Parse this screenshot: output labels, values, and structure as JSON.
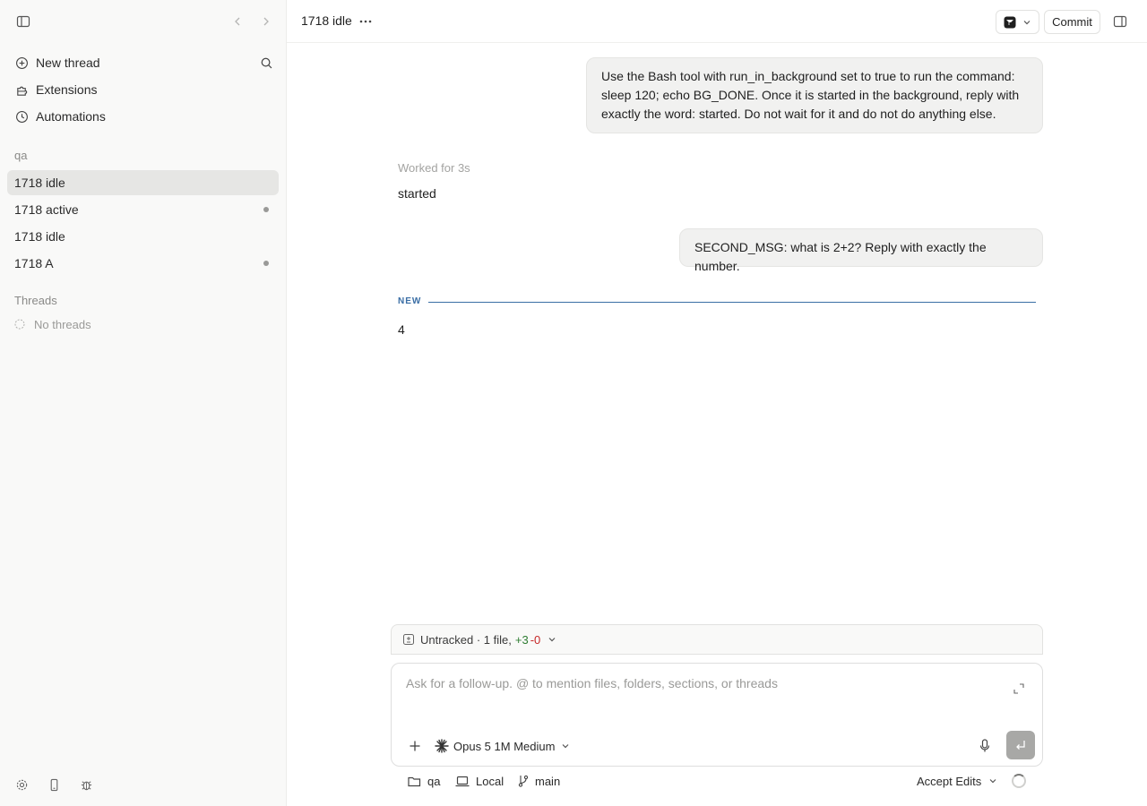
{
  "sidebar": {
    "nav": [
      {
        "label": "New thread",
        "icon": "plus-circle-icon"
      },
      {
        "label": "Extensions",
        "icon": "puzzle-icon"
      },
      {
        "label": "Automations",
        "icon": "clock-icon"
      }
    ],
    "project_label": "qa",
    "project_threads": [
      {
        "label": "1718 idle",
        "active": true,
        "dot": false
      },
      {
        "label": "1718 active",
        "active": false,
        "dot": true
      },
      {
        "label": "1718 idle",
        "active": false,
        "dot": false
      },
      {
        "label": "1718 A",
        "active": false,
        "dot": true
      }
    ],
    "threads_label": "Threads",
    "no_threads": "No threads"
  },
  "header": {
    "title": "1718 idle",
    "commit_label": "Commit"
  },
  "conversation": {
    "user_message_1": "Use the Bash tool with run_in_background set to true to run the command: sleep 120; echo BG_DONE. Once it is started in the background, reply with exactly the word: started. Do not wait for it and do not do anything else.",
    "worked_for": "Worked for 3s",
    "assistant_reply_1": "started",
    "user_message_2": "SECOND_MSG: what is 2+2? Reply with exactly the number.",
    "new_label": "NEW",
    "assistant_reply_2": "4"
  },
  "composer": {
    "untracked_prefix": "Untracked · 1 file,",
    "untracked_plus": "+3",
    "untracked_minus": "-0",
    "placeholder": "Ask for a follow-up. @ to mention files, folders, sections, or threads",
    "model_label": "Opus 5 1M Medium"
  },
  "footer": {
    "folder": "qa",
    "env": "Local",
    "branch": "main",
    "accept_label": "Accept Edits"
  },
  "colors": {
    "accent": "#3a6ea5",
    "diff_add": "#2e7d32",
    "diff_remove": "#c62828"
  }
}
